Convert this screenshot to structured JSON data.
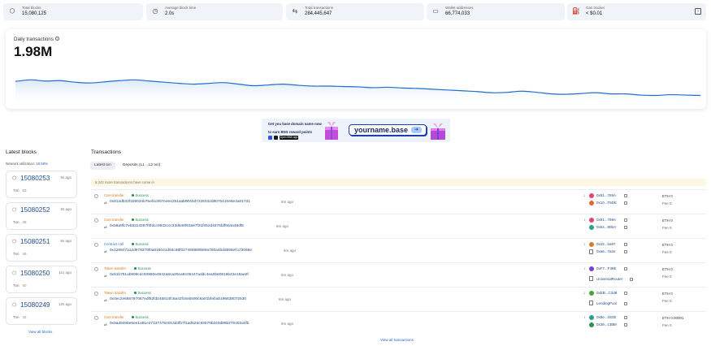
{
  "stats": [
    {
      "icon": "cube-icon",
      "label": "Total blocks",
      "value": "15,080,125"
    },
    {
      "icon": "clock-icon",
      "label": "Average block time",
      "value": "2.0s"
    },
    {
      "icon": "arrows-icon",
      "label": "Total transactions",
      "value": "284,445,647"
    },
    {
      "icon": "wallet-icon",
      "label": "Wallet addresses",
      "value": "66,774,033"
    },
    {
      "icon": "gas-icon",
      "label": "Gas tracker",
      "value": "< $0.01"
    }
  ],
  "daily_chart": {
    "title": "Daily transactions",
    "value": "1.98M",
    "line_color": "#1e6fd1",
    "fill_color": "#d8e8f8"
  },
  "chart_data": {
    "type": "area",
    "title": "Daily transactions",
    "values": [
      0.62,
      0.66,
      0.63,
      0.64,
      0.6,
      0.58,
      0.61,
      0.64,
      0.66,
      0.63,
      0.6,
      0.57,
      0.55,
      0.57,
      0.59,
      0.55,
      0.51,
      0.53,
      0.55,
      0.52,
      0.5,
      0.5,
      0.49,
      0.48,
      0.46,
      0.47,
      0.45,
      0.44,
      0.42,
      0.4,
      0.38,
      0.36,
      0.33,
      0.34,
      0.37,
      0.34,
      0.3,
      0.29,
      0.31,
      0.33,
      0.3,
      0.3,
      0.27,
      0.26,
      0.28,
      0.27,
      0.26
    ]
  },
  "banner": {
    "line1": "Get you base domain name now",
    "line2": "to earn BNS reward points",
    "store": "Open BNS app",
    "domain": "yourname.base",
    "arrow": "➔"
  },
  "latest_blocks": {
    "title": "Latest blocks",
    "util_label": "Network utilization:",
    "util_value": "18.58%",
    "txn_label": "Txn",
    "view_all": "View all blocks",
    "items": [
      {
        "number": "15080253",
        "age": "5s ago",
        "txn": "53"
      },
      {
        "number": "15080252",
        "age": "8s ago",
        "txn": "48"
      },
      {
        "number": "15080251",
        "age": "6s ago",
        "txn": "49"
      },
      {
        "number": "15080250",
        "age": "11s ago",
        "txn": "50"
      },
      {
        "number": "15080249",
        "age": "12s ago",
        "txn": "42"
      }
    ]
  },
  "transactions": {
    "title": "Transactions",
    "tabs": [
      "Latest txn",
      "Deposits (L1→L2 txn)"
    ],
    "notice": "6,242 more transactions have come in",
    "view_all": "View all transactions",
    "status_label": "Success",
    "fee_label": "Fee",
    "eth_label": "ETH",
    "rows": [
      {
        "type": "Coin transfer",
        "hash": "0x813db32f1b9034b75ef4c907eee4251aab904bd7225032d9075410e6e4a01731",
        "age": "6m ago",
        "from": "0x91...769A",
        "to": "0x10...F5DE",
        "eth": "0",
        "fee": "0",
        "from_color": "#e0447a",
        "to_color": "#e8603c",
        "to_is_contract": false
      },
      {
        "type": "Coin transfer",
        "hash": "0x58a9fc7eb5314287f0fdcc9932ccc33d546f93a97f31f052d4576fdf9d4a48df8",
        "age": "6m ago",
        "from": "0x91...769A",
        "to": "0x64...80bA",
        "eth": "0",
        "fee": "0",
        "from_color": "#e0447a",
        "to_color": "#2aa58a",
        "to_is_contract": false
      },
      {
        "type": "Contract call",
        "hash": "0x128847a12d978379f0a816041d84c88f027486889b89a780a4bdd865efccf3068e",
        "age": "6m ago",
        "from": "0x22...ba97",
        "to": "0xa6...7a2e",
        "eth": "0",
        "fee": "0",
        "from_color": "#d0812b",
        "to_color": "#777777",
        "to_is_contract": true
      },
      {
        "type": "Token transfer",
        "hash": "0x51b781ab909cdc93960e4942a8ca20ea9435447addc4ea0b60615b42e18ae2f",
        "age": "6m ago",
        "from": "0xF7...F38E",
        "to": "UniversalRouter",
        "eth": "0",
        "fee": "0",
        "from_color": "#7b3fd4",
        "to_color": "#777777",
        "to_is_contract": true
      },
      {
        "type": "Token transfer",
        "hash": "0x4ec2e686797057edf62fd245814fc8a42fc6eb590c8a91bfeba5196838072530",
        "age": "6m ago",
        "from": "0xEB...C3d8",
        "to": "LendingPool",
        "eth": "0",
        "fee": "0",
        "from_color": "#4aa336",
        "to_color": "#777777",
        "to_is_contract": true
      },
      {
        "type": "Coin transfer",
        "hash": "0x5ad946be6ee1a91e271374784013d3fb7f1ad525c93570b340d88b276403a4fb",
        "age": "6m ago",
        "from": "0x8e...1B3E",
        "to": "0x39...CB89",
        "eth": "0.00001",
        "fee": "0",
        "from_color": "#2a9e8c",
        "to_color": "#2f8f54",
        "to_is_contract": false
      }
    ]
  }
}
